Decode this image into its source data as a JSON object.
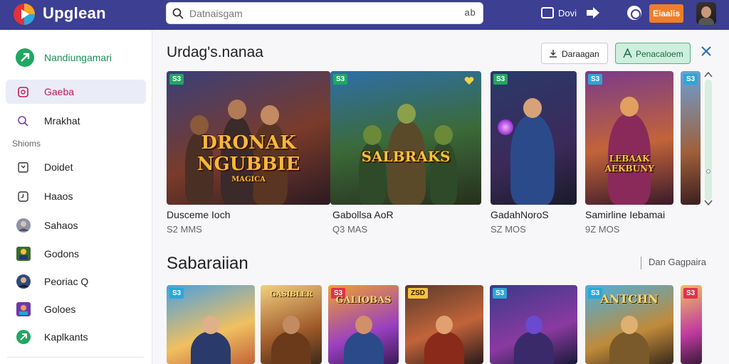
{
  "app": {
    "title": "Upglean",
    "brand_colors": {
      "bar": "#3c3f92",
      "accent": "#ef7d2a",
      "green": "#1fa861"
    }
  },
  "search": {
    "placeholder": "Datnaisgam",
    "shortcut": "ab"
  },
  "topbar": {
    "downloads_label": "Dovi",
    "profile_button": "Eiaalis"
  },
  "sidebar": {
    "brand_label": "Nandiungamari",
    "items": [
      {
        "label": "Gaeba",
        "icon": "games-icon",
        "active": true
      },
      {
        "label": "Mrakhat",
        "icon": "market-icon",
        "active": false
      }
    ],
    "section_label": "Shioms",
    "sub_items": [
      {
        "label": "Doidet",
        "icon": "box-icon"
      },
      {
        "label": "Haaos",
        "icon": "clock-icon"
      },
      {
        "label": "Sahaos",
        "icon": "avatar-icon"
      },
      {
        "label": "Godons",
        "icon": "game-thumb-icon"
      },
      {
        "label": "Peoriac Q",
        "icon": "avatar-icon"
      },
      {
        "label": "Goloes",
        "icon": "game-thumb-icon"
      },
      {
        "label": "Kaplkants",
        "icon": "brand-icon"
      }
    ]
  },
  "main": {
    "section1": {
      "title": "Urdag's.nanaa",
      "btn_outline": "Daraagan",
      "btn_green": "Penacaloem",
      "games": [
        {
          "name": "Dusceme Ioch",
          "size": "S2 MMS",
          "badge": "S3",
          "art_title": "DRONAK NGUBBIE",
          "art_sub": "MAGICA"
        },
        {
          "name": "Gabollsa AoR",
          "size": "Q3 MAS",
          "badge": "S3",
          "art_title": "SALBRAKS",
          "art_sub": ""
        },
        {
          "name": "GadahNoroS",
          "size": "SZ MOS",
          "badge": "S3",
          "art_title": "",
          "art_sub": ""
        },
        {
          "name": "Samirline Iebamai",
          "size": "9Z MOS",
          "badge": "S3",
          "art_title": "LEBAAK AEKBUNY",
          "art_sub": ""
        }
      ]
    },
    "section2": {
      "title": "Sabaraiian",
      "see_all": "Dan Gagpaira",
      "tiles": [
        {
          "badge": "S3",
          "word": ""
        },
        {
          "badge": "",
          "word": "GASIBLER"
        },
        {
          "badge": "S3",
          "word": "GALIOBAS"
        },
        {
          "badge": "ZSD",
          "word": ""
        },
        {
          "badge": "S3",
          "word": ""
        },
        {
          "badge": "S3",
          "word": "ANTCHN"
        },
        {
          "badge": "S3",
          "word": ""
        }
      ]
    }
  }
}
